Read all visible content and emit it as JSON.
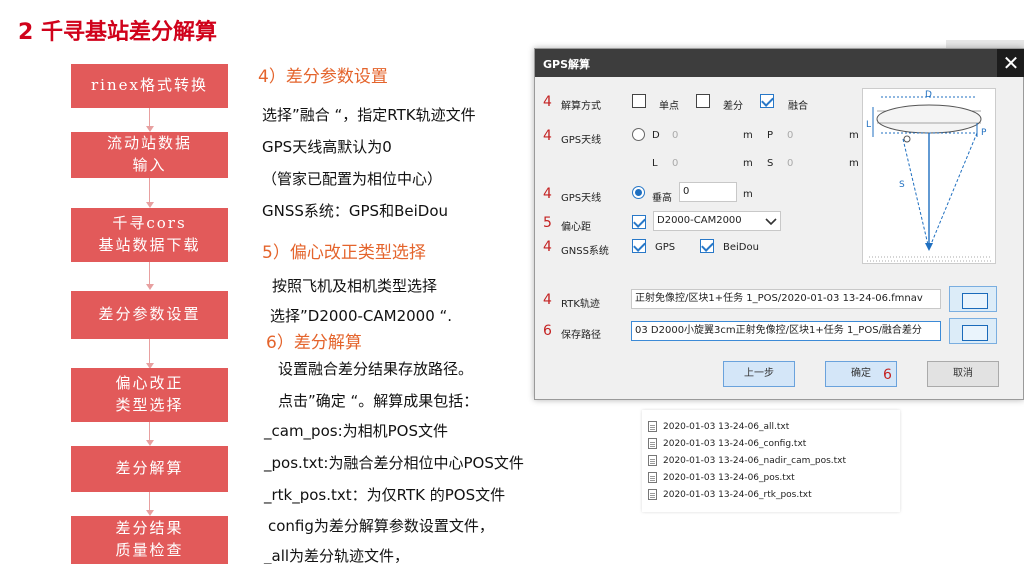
{
  "slide": {
    "title": "2  千寻基站差分解算"
  },
  "flow": {
    "steps": [
      {
        "line1": "rinex格式转换",
        "line2": ""
      },
      {
        "line1": "流动站数据",
        "line2": "输入"
      },
      {
        "line1": "千寻cors",
        "line2": "基站数据下载"
      },
      {
        "line1": "差分参数设置",
        "line2": ""
      },
      {
        "line1": "偏心改正",
        "line2": "类型选择"
      },
      {
        "line1": "差分解算",
        "line2": ""
      },
      {
        "line1": "差分结果",
        "line2": "质量检查"
      }
    ]
  },
  "text": {
    "s4_heading": "4）差分参数设置",
    "s4_lines": [
      "选择”融合 “，指定RTK轨迹文件",
      "GPS天线高默认为0",
      "（管家已配置为相位中心）",
      "GNSS系统：GPS和BeiDou"
    ],
    "s5_heading": "5）偏心改正类型选择",
    "s5_lines": [
      "按照飞机及相机类型选择",
      "选择”D2000-CAM2000 “."
    ],
    "s6_heading": "6）差分解算",
    "s6_lines": [
      "设置融合差分结果存放路径。",
      "点击”确定 “。解算成果包括：",
      "_cam_pos:为相机POS文件",
      "_pos.txt:为融合差分相位中心POS文件",
      "_rtk_pos.txt：为仅RTK 的POS文件",
      "config为差分解算参数设置文件，",
      "_all为差分轨迹文件，"
    ]
  },
  "dialog": {
    "title": "GPS解算",
    "close": "✕",
    "mode": {
      "num": "4",
      "label": "解算方式",
      "opt_single": "单点",
      "opt_diff": "差分",
      "opt_fusion": "融合"
    },
    "antenna": {
      "num": "4",
      "label": "GPS天线",
      "d": "D",
      "d_val": "0",
      "m1": "m",
      "p": "P",
      "p_val": "0",
      "m2": "m",
      "l": "L",
      "l_val": "0",
      "m3": "m",
      "s": "S",
      "s_val": "0",
      "m4": "m"
    },
    "antenna_h": {
      "num": "4",
      "label": "GPS天线",
      "opt_vertical": "垂高",
      "value": "0",
      "unit": "m"
    },
    "offset": {
      "num": "5",
      "label": "偏心距",
      "selected": "D2000-CAM2000"
    },
    "gnss": {
      "num": "4",
      "label": "GNSS系统",
      "gps": "GPS",
      "beidou": "BeiDou"
    },
    "rtk": {
      "num": "4",
      "label": "RTK轨迹",
      "value": "正射免像控/区块1+任务 1_POS/2020-01-03 13-24-06.fmnav"
    },
    "save": {
      "num": "6",
      "label": "保存路径",
      "value": "03 D2000小旋翼3cm正射免像控/区块1+任务 1_POS/融合差分"
    },
    "buttons": {
      "prev": "上一步",
      "ok": "确定",
      "ok_num": "6",
      "cancel": "取消"
    },
    "diagram": {
      "d": "D",
      "l": "L",
      "p": "P",
      "s": "S"
    }
  },
  "files": [
    "2020-01-03 13-24-06_all.txt",
    "2020-01-03 13-24-06_config.txt",
    "2020-01-03 13-24-06_nadir_cam_pos.txt",
    "2020-01-03 13-24-06_pos.txt",
    "2020-01-03 13-24-06_rtk_pos.txt"
  ],
  "colors": {
    "title": "#d0021b",
    "flow_box": "#e25a5a",
    "heading": "#e4642c",
    "accent": "#2878c8"
  }
}
